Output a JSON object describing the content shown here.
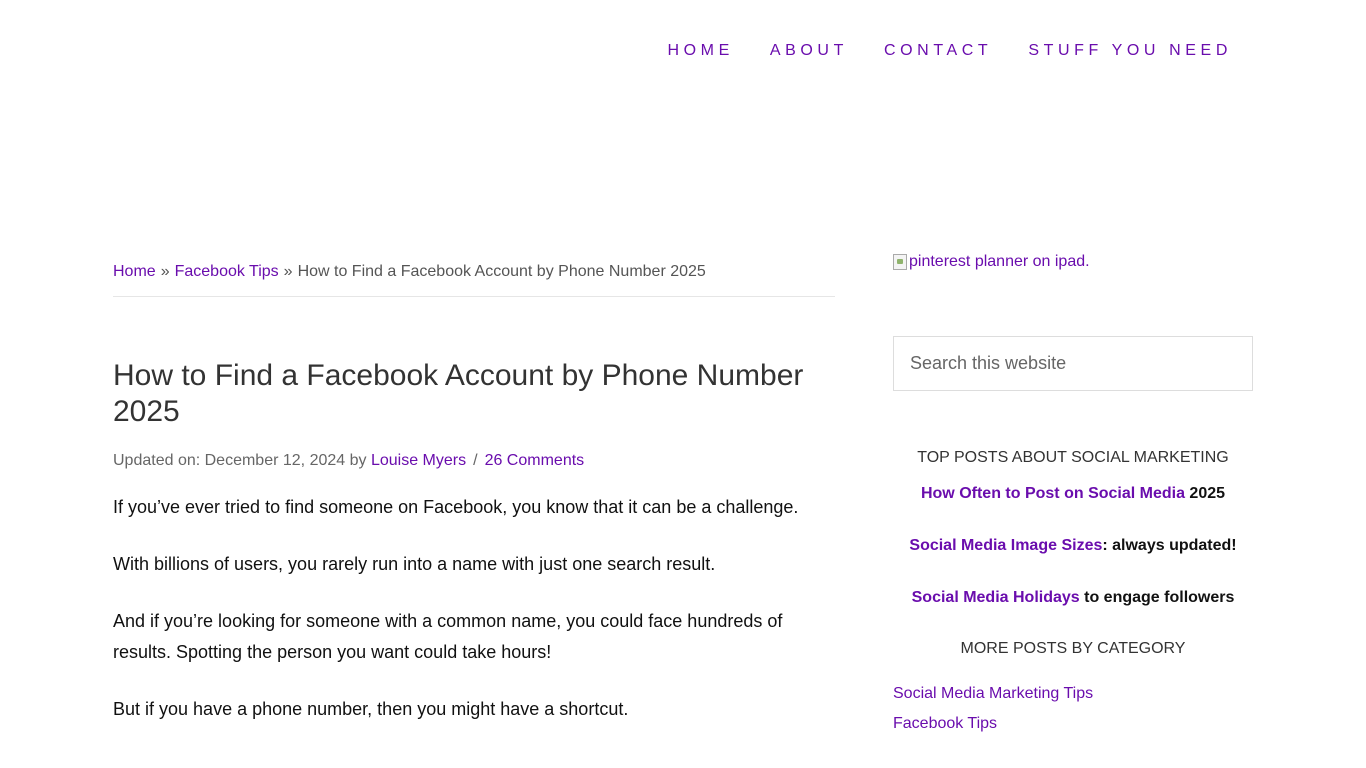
{
  "nav": {
    "items": [
      {
        "label": "HOME"
      },
      {
        "label": "ABOUT"
      },
      {
        "label": "CONTACT"
      },
      {
        "label": "STUFF YOU NEED"
      }
    ]
  },
  "breadcrumb": {
    "home": "Home",
    "separator": "»",
    "category": "Facebook Tips",
    "current": "How to Find a Facebook Account by Phone Number 2025"
  },
  "article": {
    "title": "How to Find a Facebook Account by Phone Number 2025",
    "meta": {
      "updated_prefix": "Updated on: December 12, 2024 by",
      "author": "Louise Myers",
      "separator": "/",
      "comments": "26 Comments"
    },
    "paragraphs": [
      "If you’ve ever tried to find someone on Facebook, you know that it can be a challenge.",
      "With billions of users, you rarely run into a name with just one search result.",
      "And if you’re looking for someone with a common name, you could face hundreds of results. Spotting the person you want could take hours!",
      "But if you have a phone number, then you might have a shortcut."
    ]
  },
  "sidebar": {
    "image_alt": "pinterest planner on ipad.",
    "search": {
      "placeholder": "Search this website",
      "value": ""
    },
    "top_posts": {
      "title": "TOP POSTS ABOUT SOCIAL MARKETING",
      "items": [
        {
          "link": "How Often to Post on Social Media",
          "suffix": " 2025"
        },
        {
          "link": "Social Media Image Sizes",
          "suffix": ": always updated!"
        },
        {
          "link": "Social Media Holidays",
          "suffix": " to engage followers"
        }
      ]
    },
    "categories": {
      "title": "MORE POSTS BY CATEGORY",
      "items": [
        {
          "label": "Social Media Marketing Tips"
        },
        {
          "label": "Facebook Tips"
        }
      ]
    }
  },
  "colors": {
    "link": "#6a0dad",
    "text": "#111111",
    "muted": "#666666"
  }
}
